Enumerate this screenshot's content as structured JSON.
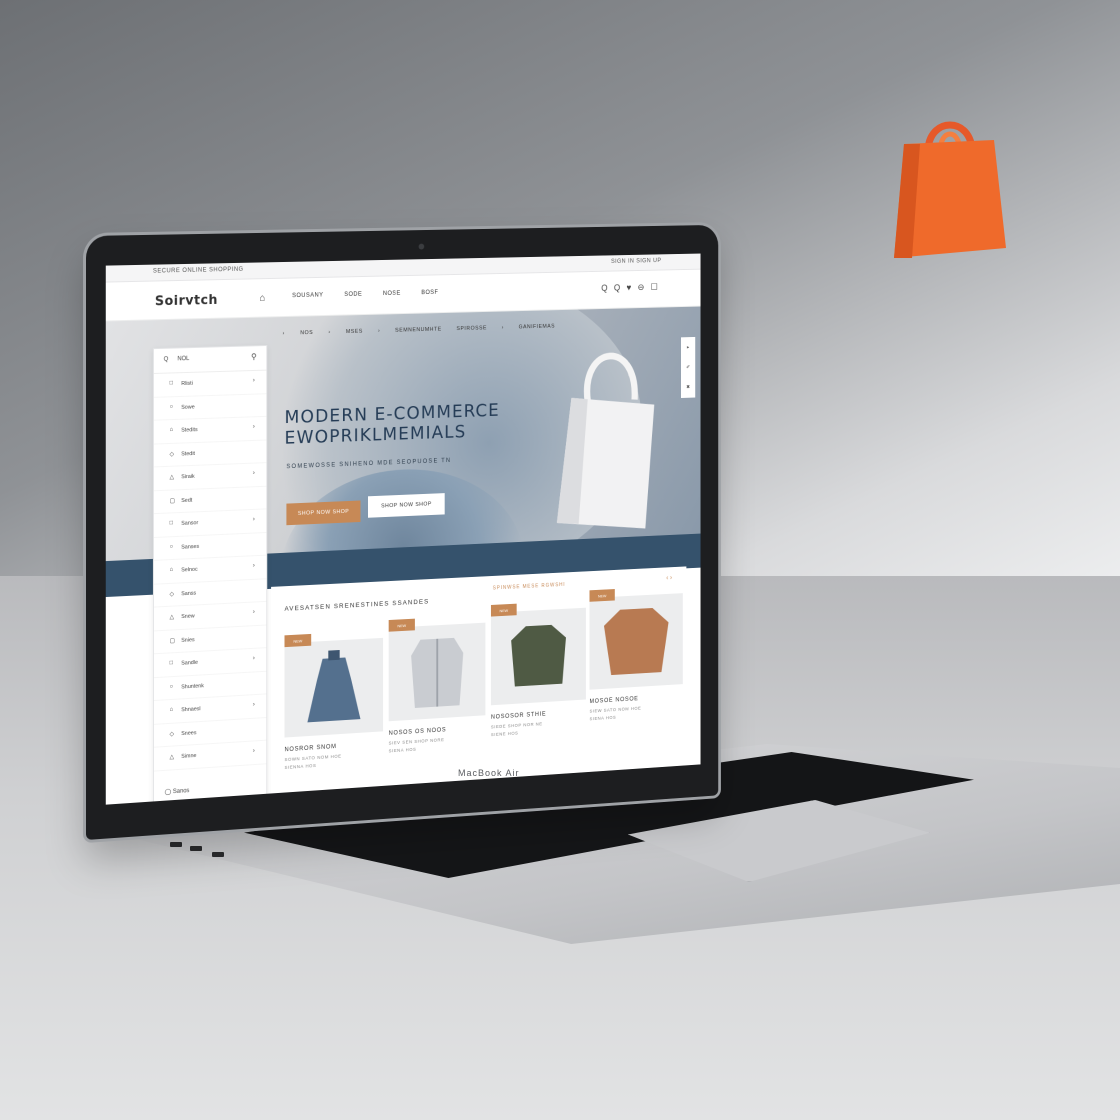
{
  "scene": {
    "laptop_brand": "MacBook Air"
  },
  "site": {
    "topbar_left": "SECURE ONLINE SHOPPING",
    "topbar_right": "SIGN IN  SIGN UP",
    "logo": "Soirvtch",
    "nav": [
      "SOUSANY",
      "SODE",
      "NOSE",
      "BOSF"
    ],
    "header_icons": {
      "search": "Q",
      "account": "Q",
      "wishlist": "♥",
      "bag": "⊖",
      "cart": "☐"
    }
  },
  "hero": {
    "breadcrumbs": [
      "›",
      "NOS",
      "›",
      "MSES",
      "›",
      "SEMNENUMHTE",
      "SPIROSSE",
      "›",
      "GANIFIEMAS"
    ],
    "title_line1": "MODERN E-COMMERCE",
    "title_line2": "EWOPRIKLMEMIALS",
    "subtitle": "SOMEWOSSE  SNIHENO MDE  SEOPUOSE TN",
    "primary_button": "SHOP NOW SHOP",
    "secondary_button": "SHOP NOW SHOP",
    "side_strip": [
      "▸",
      "✐",
      "✖"
    ]
  },
  "sidebar": {
    "search_label": "NOL",
    "items": [
      {
        "label": "Rlisti",
        "icon": "□"
      },
      {
        "label": "Sowe",
        "icon": "○"
      },
      {
        "label": "Stedits",
        "icon": "⌂"
      },
      {
        "label": "Stedit",
        "icon": "◇"
      },
      {
        "label": "Siraik",
        "icon": "△"
      },
      {
        "label": "Sedt",
        "icon": "▢"
      },
      {
        "label": "Sansor",
        "icon": "□"
      },
      {
        "label": "Sanses",
        "icon": "○"
      },
      {
        "label": "Selnoc",
        "icon": "⌂"
      },
      {
        "label": "Sanss",
        "icon": "◇"
      },
      {
        "label": "Snew",
        "icon": "△"
      },
      {
        "label": "Snies",
        "icon": "▢"
      },
      {
        "label": "Sandle",
        "icon": "□"
      },
      {
        "label": "Shuntenk",
        "icon": "○"
      },
      {
        "label": "Shnaesl",
        "icon": "⌂"
      },
      {
        "label": "Snees",
        "icon": "◇"
      },
      {
        "label": "Simne",
        "icon": "△"
      }
    ],
    "footer_label": "Sanos"
  },
  "products": {
    "title": "AVESATSEN SRENESTINES SSANDES",
    "subtitle": "SPINWSE MESE RGWSHI",
    "nav_arrows": "‹ ›",
    "items": [
      {
        "badge": "NEW",
        "name": "NOSROR SNOM",
        "desc": "SOWN SATO NOM HOE",
        "desc2": "SIENNA HOS",
        "item": "dress"
      },
      {
        "badge": "NEW",
        "name": "NOSOS OS NOOS",
        "desc": "SIEV SEN SHOP NORE",
        "desc2": "SIENA HOS",
        "item": "cardigan"
      },
      {
        "badge": "NEW",
        "name": "NOSOSOR STHIE",
        "desc": "SIEDE SHOP NOR NE",
        "desc2": "SIENE HOS",
        "item": "olive-top"
      },
      {
        "badge": "NEW",
        "name": "MOSOE NOSOE",
        "desc": "SIEW SATO NOM HOE",
        "desc2": "SIENA HOS",
        "item": "tan-sweater"
      }
    ]
  },
  "colors": {
    "accent": "#c78956",
    "navy": "#253c56",
    "band": "#35526c",
    "bag_orange": "#ef6a2b"
  }
}
